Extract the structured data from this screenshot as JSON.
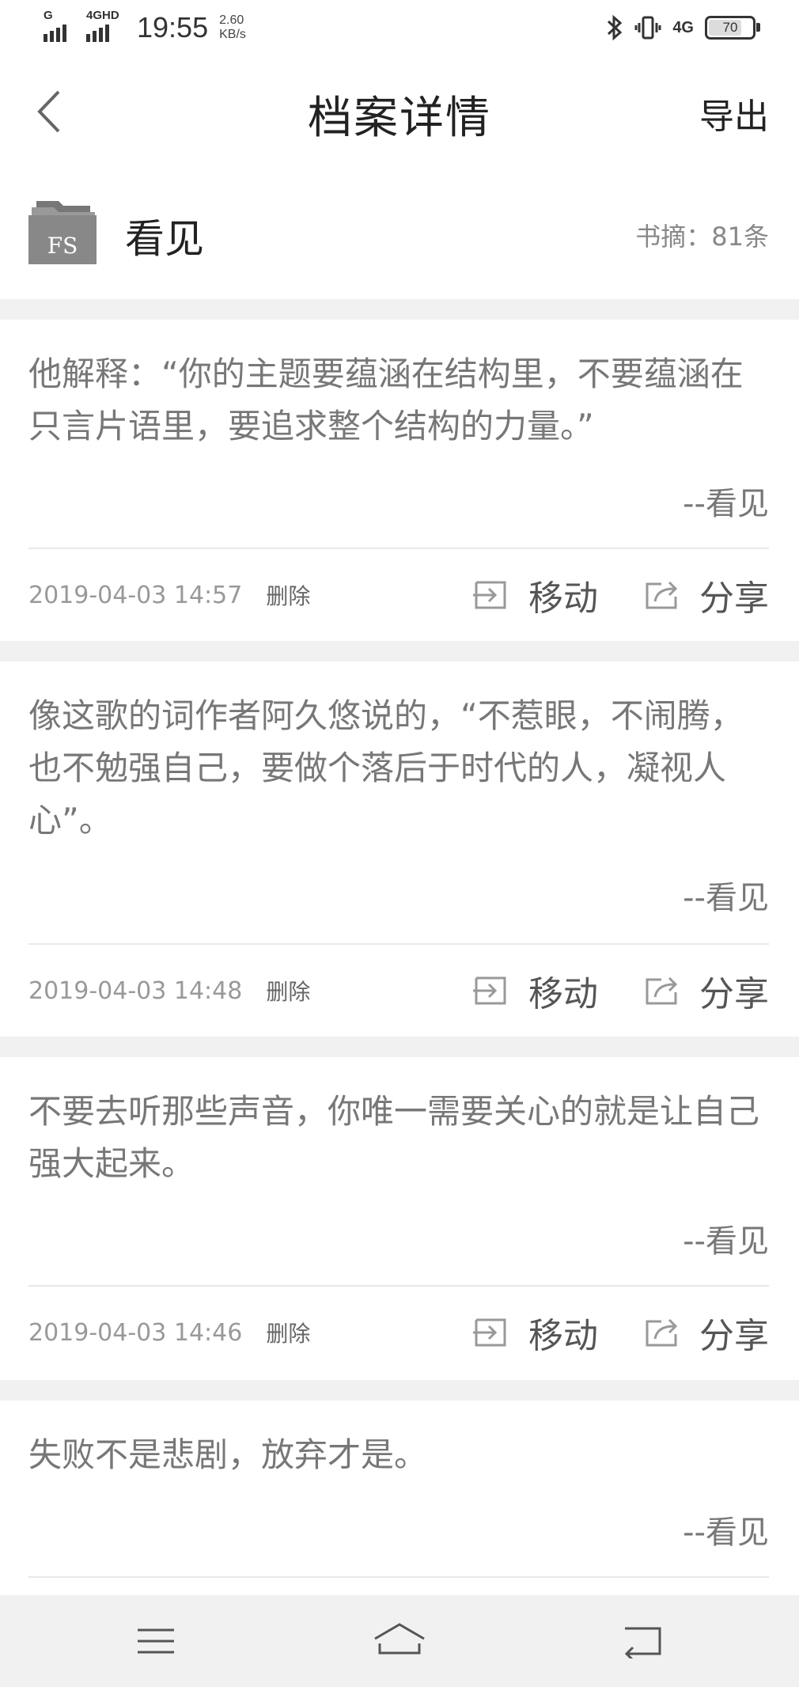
{
  "status_bar": {
    "signal1_label": "G",
    "signal2_label": "4GHD",
    "time": "19:55",
    "speed_value": "2.60",
    "speed_unit": "KB/s",
    "network_label": "4G",
    "battery": "70"
  },
  "header": {
    "title": "档案详情",
    "export_label": "导出"
  },
  "archive": {
    "icon_text": "FS",
    "name": "看见",
    "excerpt_count": "书摘：81条"
  },
  "excerpts": [
    {
      "text": "他解释：“你的主题要蕴涵在结构里，不要蕴涵在只言片语里，要追求整个结构的力量。”",
      "author": "--看见",
      "date": "2019-04-03 14:57",
      "delete_label": "删除",
      "move_label": "移动",
      "share_label": "分享"
    },
    {
      "text": "像这歌的词作者阿久悠说的，“不惹眼，不闹腾，也不勉强自己，要做个落后于时代的人，凝视人心”。",
      "author": "--看见",
      "date": "2019-04-03 14:48",
      "delete_label": "删除",
      "move_label": "移动",
      "share_label": "分享"
    },
    {
      "text": "不要去听那些声音，你唯一需要关心的就是让自己强大起来。",
      "author": "--看见",
      "date": "2019-04-03 14:46",
      "delete_label": "删除",
      "move_label": "移动",
      "share_label": "分享"
    },
    {
      "text": "失败不是悲剧，放弃才是。",
      "author": "--看见"
    }
  ],
  "colors": {
    "background": "#ffffff",
    "separator": "#f1f1f1",
    "quote_text": "#777777",
    "meta_text": "#999999"
  },
  "icons": {
    "back": "chevron-left-icon",
    "folder": "folder-fs-icon",
    "move": "move-in-icon",
    "share": "share-icon",
    "menu": "menu-icon",
    "home": "home-icon",
    "return": "return-icon"
  }
}
